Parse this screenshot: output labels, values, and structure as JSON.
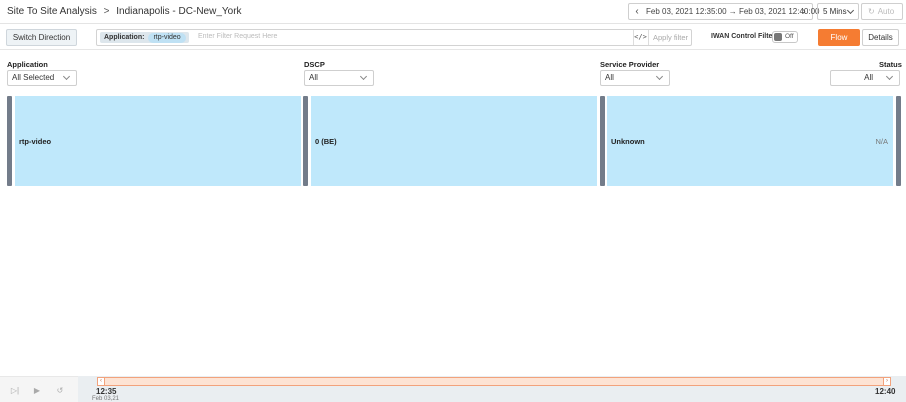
{
  "header": {
    "breadcrumb_root": "Site To Site Analysis",
    "breadcrumb_separator": ">",
    "breadcrumb_current": "Indianapolis - DC-New_York",
    "time_range": "Feb 03, 2021 12:35:00 → Feb 03, 2021 12:40:00",
    "interval": "5 Mins",
    "auto_label": "Auto",
    "icons": {
      "prev": "chevron-left-icon",
      "next": "chevron-right-icon",
      "refresh": "refresh-icon"
    }
  },
  "toolbar": {
    "switch_direction": "Switch Direction",
    "filter_key": "Application:",
    "filter_value": "rtp-video",
    "filter_placeholder": "Enter Filter Request Here",
    "code_icon": "</>",
    "apply_filter": "Apply filter",
    "iwan_label": "IWAN Control Filter",
    "iwan_state": "Off",
    "flow_button": "Flow",
    "details_button": "Details"
  },
  "columns": [
    {
      "header": "Application",
      "selected": "All Selected"
    },
    {
      "header": "DSCP",
      "selected": "All"
    },
    {
      "header": "Service Provider",
      "selected": "All"
    },
    {
      "header": "Status",
      "selected": "All"
    }
  ],
  "flow": {
    "nodes": [
      {
        "label": "rtp-video"
      },
      {
        "label": "0 (BE)"
      },
      {
        "label": "Unknown",
        "status": "N/A"
      }
    ],
    "colors": {
      "node_fill": "#bfe8fb",
      "bar": "#737c8a"
    }
  },
  "timeline": {
    "start_time": "12:35",
    "start_date": "Feb 03,21",
    "end_time": "12:40",
    "controls": [
      "skip-to-end-icon",
      "play-icon",
      "reset-icon"
    ]
  },
  "accent": "#f57c32"
}
